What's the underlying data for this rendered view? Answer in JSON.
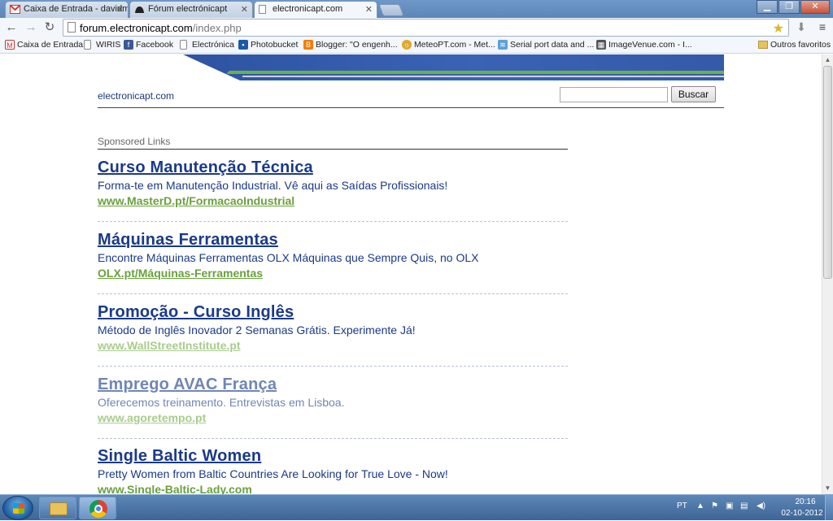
{
  "browser": {
    "tabs": [
      {
        "label": "Caixa de Entrada - davidm",
        "icon": "gmail-icon"
      },
      {
        "label": "Fórum electrónicapt",
        "icon": "forum-icon"
      },
      {
        "label": "electronicapt.com",
        "icon": "page-icon"
      }
    ],
    "url_domain": "forum.electronicapt.com",
    "url_path": "/index.php",
    "bookmarks": [
      {
        "label": "Caixa de Entrada",
        "icon": "gmail-icon"
      },
      {
        "label": "WIRIS",
        "icon": "page-icon"
      },
      {
        "label": "Facebook",
        "icon": "facebook-icon"
      },
      {
        "label": "Electrónica",
        "icon": "page-icon"
      },
      {
        "label": "Photobucket",
        "icon": "photobucket-icon"
      },
      {
        "label": "Blogger: \"O engenh...",
        "icon": "blogger-icon"
      },
      {
        "label": "MeteoPT.com - Met...",
        "icon": "meteo-icon"
      },
      {
        "label": "Serial port data and ...",
        "icon": "serial-icon"
      },
      {
        "label": "ImageVenue.com - I...",
        "icon": "imagevenue-icon"
      }
    ],
    "other_bookmarks": "Outros favoritos",
    "colors": {
      "accent": "#1a3a88",
      "url_green": "#6aa03c",
      "banner_blue": "#3a63b5"
    }
  },
  "page": {
    "site_name": "electronicapt.com",
    "search_button": "Buscar",
    "search_value": "",
    "sponsored_label": "Sponsored Links",
    "ads": [
      {
        "title": "Curso Manutenção Técnica",
        "desc": "Forma-te em Manutenção Industrial. Vê aqui as Saídas Profissionais!",
        "url": "www.MasterD.pt/FormacaoIndustrial"
      },
      {
        "title": "Máquinas Ferramentas",
        "desc": "Encontre Máquinas Ferramentas OLX Máquinas que Sempre Quis, no OLX",
        "url": "OLX.pt/Máquinas-Ferramentas"
      },
      {
        "title": "Promoção - Curso Inglês",
        "desc": "Método de Inglês Inovador 2 Semanas Grátis. Experimente Já!",
        "url": "www.WallStreetInstitute.pt"
      },
      {
        "title": "Emprego AVAC França",
        "desc": "Oferecemos treinamento. Entrevistas em Lisboa.",
        "url": "www.agoretempo.pt"
      },
      {
        "title": "Single Baltic Women",
        "desc": "Pretty Women from Baltic Countries Are Looking for True Love - Now!",
        "url": "www.Single-Baltic-Lady.com"
      }
    ]
  },
  "taskbar": {
    "language": "PT",
    "time": "20:16",
    "date": "02-10-2012"
  }
}
